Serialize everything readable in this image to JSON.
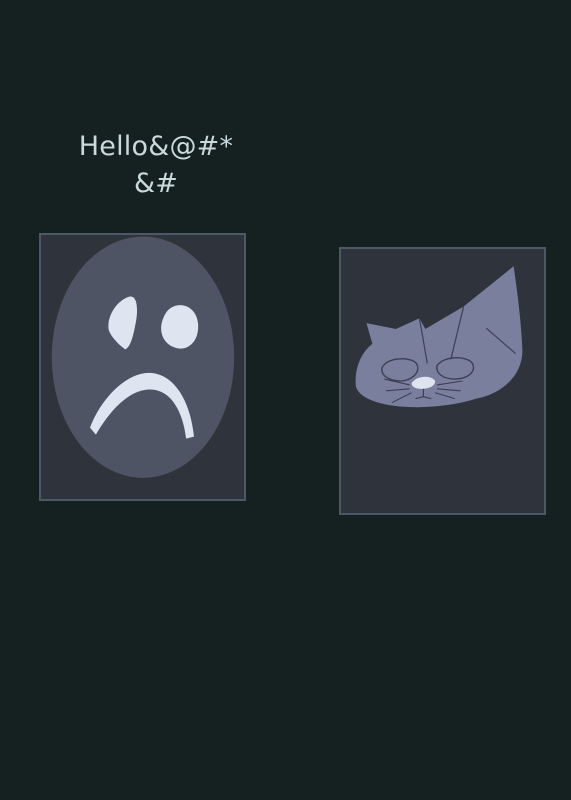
{
  "greeting": {
    "line1": "Hello&@#*",
    "line2": "&#"
  },
  "cards": [
    {
      "icon": "sad-face-icon"
    },
    {
      "icon": "cat-face-icon"
    }
  ],
  "colors": {
    "background": "#152020",
    "text": "#c9d9dc",
    "card_fill": "#2f343c",
    "card_border": "#4c5865",
    "face_fill": "#4e5464",
    "face_features": "#dfe4f1",
    "cat_fill": "#7a7f9e",
    "cat_lines": "#3c3f52",
    "cat_nose": "#dfe4f1"
  }
}
